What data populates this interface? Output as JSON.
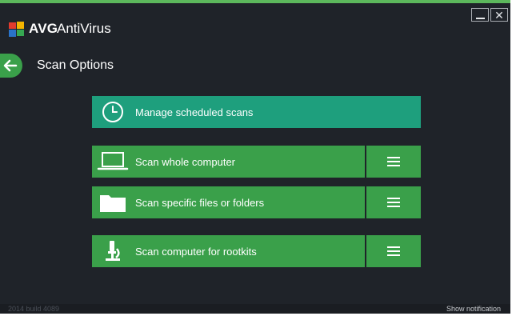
{
  "app": {
    "brand": "AVG",
    "product": "AntiVirus"
  },
  "window_controls": {
    "minimize": "minimize",
    "close": "close"
  },
  "page": {
    "title": "Scan Options"
  },
  "options": [
    {
      "label": "Manage scheduled scans",
      "icon": "clock-icon",
      "color": "#1e9f7d"
    },
    {
      "label": "Scan whole computer",
      "icon": "laptop-icon",
      "color": "#3aa04a"
    },
    {
      "label": "Scan specific files or folders",
      "icon": "folder-icon",
      "color": "#3aa04a"
    },
    {
      "label": "Scan computer for rootkits",
      "icon": "microscope-icon",
      "color": "#3aa04a"
    }
  ],
  "footer": {
    "build": "2014  build 4089",
    "notification_link": "Show notification"
  },
  "colors": {
    "background": "#1f2329",
    "accent_green": "#3aa04a",
    "teal": "#1e9f7d",
    "top_stripe": "#5cb85c"
  }
}
